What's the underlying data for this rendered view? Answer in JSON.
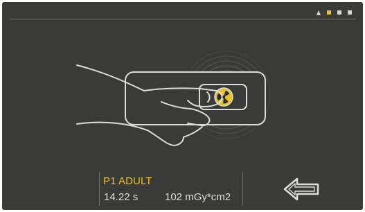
{
  "colors": {
    "background": "#3a3a37",
    "accent": "#e8c22a",
    "line": "#dcdcdc",
    "text": "#dedede"
  },
  "status_bar": {
    "indicators": [
      {
        "icon": "warning-triangle-icon",
        "active": false
      },
      {
        "icon": "status-square-icon",
        "active": true
      },
      {
        "icon": "status-square-icon",
        "active": false
      },
      {
        "icon": "status-square-icon",
        "active": false
      }
    ]
  },
  "illustration": {
    "subject": "hand pressing exposure button",
    "button_icon": "radiation-trefoil-icon"
  },
  "exposure_info": {
    "protocol": "P1 ADULT",
    "time": "14.22 s",
    "dose": "102 mGy*cm2"
  },
  "navigation": {
    "back_icon": "back-arrow-icon"
  }
}
